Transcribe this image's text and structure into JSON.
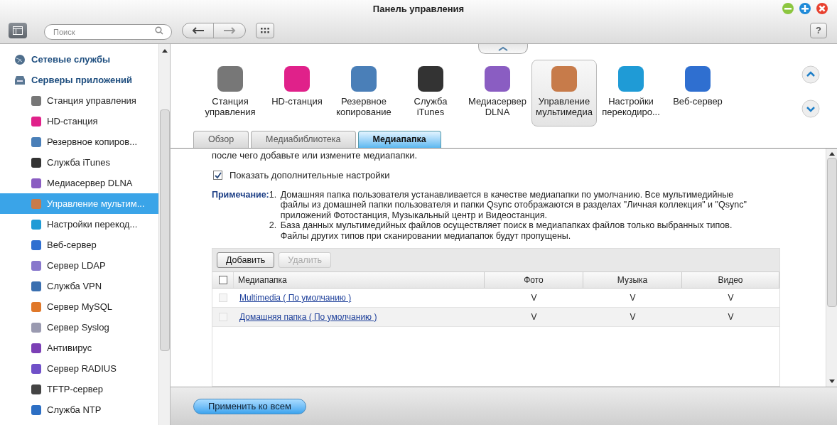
{
  "window": {
    "title": "Панель управления"
  },
  "toolbar": {
    "search": {
      "placeholder": "Поиск"
    },
    "help": "?"
  },
  "sidebar": {
    "sections": [
      {
        "label": "Сетевые службы"
      },
      {
        "label": "Серверы приложений",
        "items": [
          {
            "label": "Станция управления",
            "selected": false
          },
          {
            "label": "HD-станция",
            "selected": false
          },
          {
            "label": "Резервное копиров...",
            "selected": false
          },
          {
            "label": "Служба iTunes",
            "selected": false
          },
          {
            "label": "Медиасервер DLNA",
            "selected": false
          },
          {
            "label": "Управление мультим...",
            "selected": true
          },
          {
            "label": "Настройки перекод...",
            "selected": false
          },
          {
            "label": "Веб-сервер",
            "selected": false
          },
          {
            "label": "Сервер LDAP",
            "selected": false
          },
          {
            "label": "Служба VPN",
            "selected": false
          },
          {
            "label": "Сервер MySQL",
            "selected": false
          },
          {
            "label": "Сервер Syslog",
            "selected": false
          },
          {
            "label": "Антивирус",
            "selected": false
          },
          {
            "label": "Сервер RADIUS",
            "selected": false
          },
          {
            "label": "TFTP-сервер",
            "selected": false
          },
          {
            "label": "Служба NTP",
            "selected": false
          }
        ]
      }
    ]
  },
  "apps": [
    {
      "lines": [
        "Станция",
        "управления"
      ],
      "selected": false
    },
    {
      "lines": [
        "HD-станция"
      ],
      "selected": false
    },
    {
      "lines": [
        "Резервное",
        "копирование"
      ],
      "selected": false
    },
    {
      "lines": [
        "Служба",
        "iTunes"
      ],
      "selected": false
    },
    {
      "lines": [
        "Медиасервер",
        "DLNA"
      ],
      "selected": false
    },
    {
      "lines": [
        "Управление",
        "мультимедиа"
      ],
      "selected": true
    },
    {
      "lines": [
        "Настройки",
        "перекодиро..."
      ],
      "selected": false
    },
    {
      "lines": [
        "Веб-сервер"
      ],
      "selected": false
    }
  ],
  "tabs": [
    {
      "label": "Обзор",
      "selected": false
    },
    {
      "label": "Медиабиблиотека",
      "selected": false
    },
    {
      "label": "Медиапапка",
      "selected": true
    }
  ],
  "content": {
    "intro": "после чего добавьте или измените медиапапки.",
    "show_advanced": {
      "label": "Показать дополнительные настройки",
      "checked": true
    },
    "note": {
      "label": "Примечание:",
      "items": [
        {
          "number": "1.",
          "text": "Домашняя папка пользователя устанавливается в качестве медиапапки по умолчанию. Все мультимедийные файлы из домашней папки пользователя и папки Qsync отображаются в разделах \"Личная коллекция\" и \"Qsync\" приложений Фотостанция, Музыкальный центр и Видеостанция."
        },
        {
          "number": "2.",
          "text": "База данных мультимедийных файлов осуществляет поиск в медиапапках файлов только выбранных типов. Файлы других типов при сканировании медиапапок будут пропущены."
        }
      ]
    },
    "buttons": [
      {
        "label": "Добавить",
        "disabled": false
      },
      {
        "label": "Удалить",
        "disabled": true
      }
    ],
    "table": {
      "select_all": false,
      "columns": [
        "Медиапапка",
        "Фото",
        "Музыка",
        "Видео"
      ],
      "rows": [
        {
          "checked": false,
          "name": "Multimedia ( По умолчанию )",
          "values": [
            "V",
            "V",
            "V"
          ]
        },
        {
          "checked": false,
          "name": "Домашняя папка ( По умолчанию )",
          "values": [
            "V",
            "V",
            "V"
          ]
        }
      ]
    }
  },
  "footer": {
    "apply": "Применить ко всем"
  }
}
